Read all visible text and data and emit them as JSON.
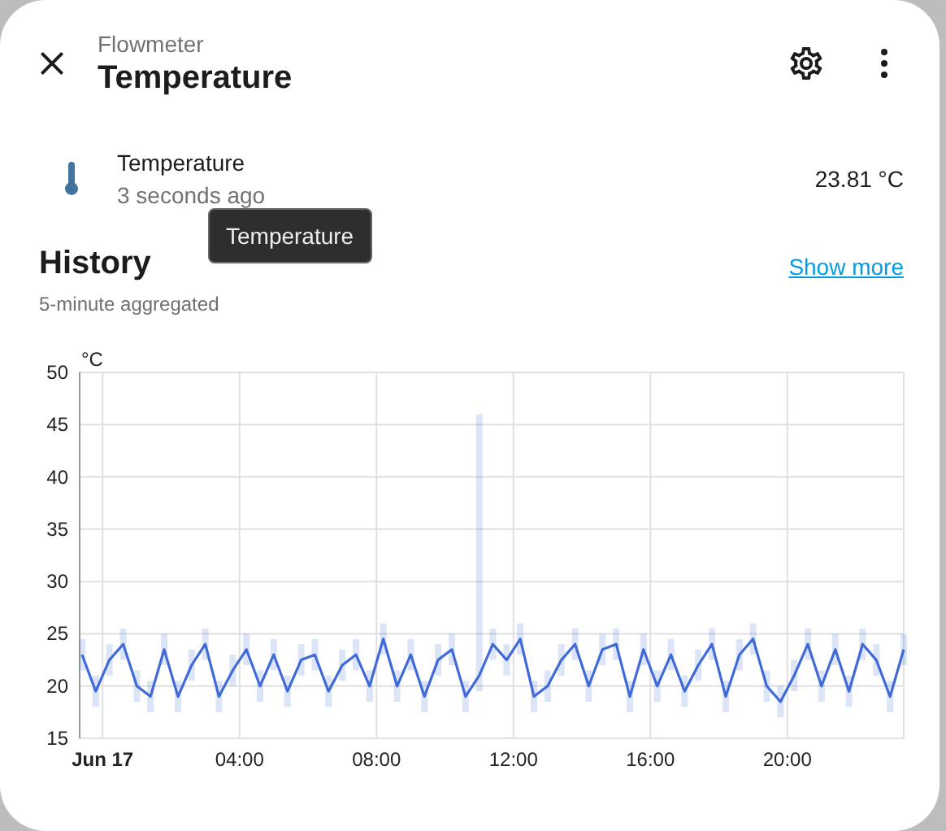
{
  "header": {
    "subtitle": "Flowmeter",
    "title": "Temperature"
  },
  "entity": {
    "name": "Temperature",
    "last_changed": "3 seconds ago",
    "state": "23.81 °C"
  },
  "tooltip": {
    "text": "Temperature"
  },
  "history": {
    "title": "History",
    "subtitle": "5-minute aggregated",
    "link": "Show more",
    "chart_data": {
      "type": "line",
      "grid": true,
      "ylabel": "°C",
      "xlim": [
        -0.67,
        23.4
      ],
      "ylim": [
        15,
        50
      ],
      "yticks": [
        15,
        20,
        25,
        30,
        35,
        40,
        45,
        50
      ],
      "xticks": [
        {
          "value": 0,
          "label": "Jun 17"
        },
        {
          "value": 4,
          "label": "04:00"
        },
        {
          "value": 8,
          "label": "08:00"
        },
        {
          "value": 12,
          "label": "12:00"
        },
        {
          "value": 16,
          "label": "16:00"
        },
        {
          "value": 20,
          "label": "20:00"
        }
      ],
      "x": [
        -0.6,
        -0.2,
        0.2,
        0.6,
        1.0,
        1.4,
        1.8,
        2.2,
        2.6,
        3.0,
        3.4,
        3.8,
        4.2,
        4.6,
        5.0,
        5.4,
        5.8,
        6.2,
        6.6,
        7.0,
        7.4,
        7.8,
        8.2,
        8.6,
        9.0,
        9.4,
        9.8,
        10.2,
        10.6,
        11.0,
        11.4,
        11.8,
        12.2,
        12.6,
        13.0,
        13.4,
        13.8,
        14.2,
        14.6,
        15.0,
        15.4,
        15.8,
        16.2,
        16.6,
        17.0,
        17.4,
        17.8,
        18.2,
        18.6,
        19.0,
        19.4,
        19.8,
        20.2,
        20.6,
        21.0,
        21.4,
        21.8,
        22.2,
        22.6,
        23.0,
        23.4
      ],
      "series": [
        {
          "color": "#3f6ad8",
          "values": [
            23,
            19.5,
            22.5,
            24,
            20,
            19,
            23.5,
            19,
            22,
            24,
            19,
            21.5,
            23.5,
            20,
            23,
            19.5,
            22.5,
            23,
            19.5,
            22,
            23,
            20,
            24.5,
            20,
            23,
            19,
            22.5,
            23.5,
            19,
            21,
            24,
            22.5,
            24.5,
            19,
            20,
            22.5,
            24,
            20,
            23.5,
            24,
            19,
            23.5,
            20,
            23,
            19.5,
            22,
            24,
            19,
            23,
            24.5,
            20,
            18.5,
            21,
            24,
            20,
            23.5,
            19.5,
            24,
            22.5,
            19,
            23.5
          ],
          "errors": [
            [
              21.5,
              24.5
            ],
            [
              18,
              21
            ],
            [
              21,
              24
            ],
            [
              22.5,
              25.5
            ],
            [
              18.5,
              21.5
            ],
            [
              17.5,
              20.5
            ],
            [
              22,
              25
            ],
            [
              17.5,
              20.5
            ],
            [
              20.5,
              23.5
            ],
            [
              22.5,
              25.5
            ],
            [
              17.5,
              20.5
            ],
            [
              20,
              23
            ],
            [
              22,
              25
            ],
            [
              18.5,
              21.5
            ],
            [
              21.5,
              24.5
            ],
            [
              18,
              21
            ],
            [
              21,
              24
            ],
            [
              21.5,
              24.5
            ],
            [
              18,
              21
            ],
            [
              20.5,
              23.5
            ],
            [
              21.5,
              24.5
            ],
            [
              18.5,
              21.5
            ],
            [
              23,
              26
            ],
            [
              18.5,
              21.5
            ],
            [
              21.5,
              24.5
            ],
            [
              17.5,
              20.5
            ],
            [
              21,
              24
            ],
            [
              22,
              25
            ],
            [
              17.5,
              20.5
            ],
            [
              19.5,
              46
            ],
            [
              22.5,
              25.5
            ],
            [
              21,
              24
            ],
            [
              23,
              26
            ],
            [
              17.5,
              20.5
            ],
            [
              18.5,
              21.5
            ],
            [
              21,
              24
            ],
            [
              22.5,
              25.5
            ],
            [
              18.5,
              21.5
            ],
            [
              22,
              25
            ],
            [
              22.5,
              25.5
            ],
            [
              17.5,
              20.5
            ],
            [
              22,
              25
            ],
            [
              18.5,
              21.5
            ],
            [
              21.5,
              24.5
            ],
            [
              18,
              21
            ],
            [
              20.5,
              23.5
            ],
            [
              22.5,
              25.5
            ],
            [
              17.5,
              20.5
            ],
            [
              21.5,
              24.5
            ],
            [
              23,
              26
            ],
            [
              18.5,
              21.5
            ],
            [
              17,
              20
            ],
            [
              19.5,
              22.5
            ],
            [
              22.5,
              25.5
            ],
            [
              18.5,
              21.5
            ],
            [
              22,
              25
            ],
            [
              18,
              21
            ],
            [
              22.5,
              25.5
            ],
            [
              21,
              24
            ],
            [
              17.5,
              20.5
            ],
            [
              22,
              25
            ]
          ]
        }
      ]
    }
  }
}
